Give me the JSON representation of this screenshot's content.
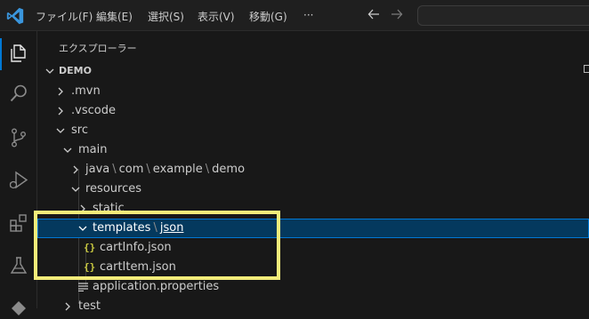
{
  "menubar": {
    "items": [
      "ファイル(F)",
      "編集(E)",
      "選択(S)",
      "表示(V)",
      "移動(G)"
    ],
    "more_label": "···"
  },
  "explorer": {
    "title": "エクスプローラー",
    "project": "DEMO",
    "rows": [
      {
        "label": ".mvn"
      },
      {
        "label": ".vscode"
      },
      {
        "label": "src"
      },
      {
        "label": "main"
      },
      {
        "segments": [
          "java",
          "com",
          "example",
          "demo"
        ]
      },
      {
        "label": "resources"
      },
      {
        "label": "static"
      },
      {
        "segments": [
          "templates",
          "json"
        ],
        "selected": true
      },
      {
        "label": "cartInfo.json"
      },
      {
        "label": "cartItem.json"
      },
      {
        "label": "application.properties"
      },
      {
        "label": "test"
      }
    ],
    "separator": "\\",
    "json_icon": "{}"
  },
  "icons": {
    "app": "vscode-logo-icon",
    "back": "arrow-left-icon",
    "forward": "arrow-right-icon",
    "activity": [
      "files-icon",
      "search-icon",
      "source-control-icon",
      "run-debug-icon",
      "extensions-icon",
      "testing-icon",
      "accounts-icon"
    ]
  },
  "colors": {
    "accent": "#0078d4",
    "selection": "#04395e",
    "json_icon": "#cbcb41",
    "annotation": "#f4ec7a"
  }
}
